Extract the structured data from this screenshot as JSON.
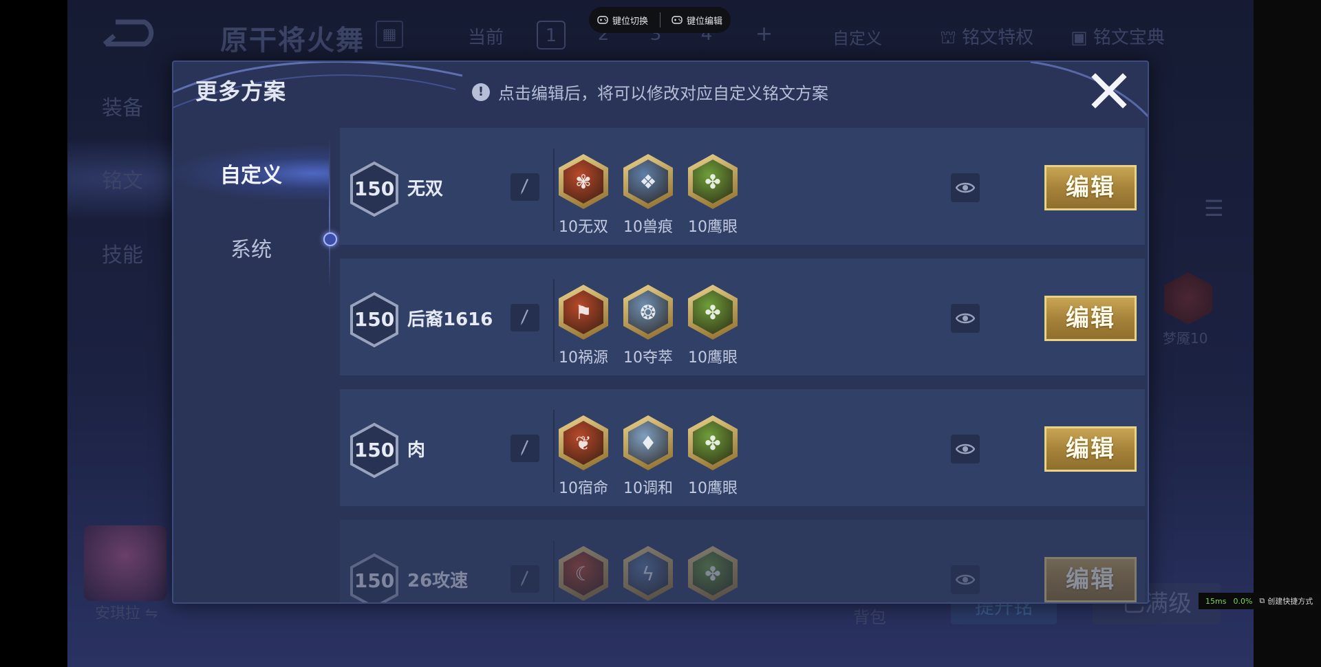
{
  "background": {
    "hero_name": "原干将火舞",
    "current_label": "当前",
    "pages": [
      "1",
      "2",
      "3",
      "4"
    ],
    "add_label": "+",
    "custom_label": "自定义",
    "privilege_label": "铭文特权",
    "codex_label": "铭文宝典",
    "tabs": [
      "装备",
      "铭文",
      "技能"
    ],
    "rune_label": "梦魇10",
    "player_name": "安琪拉",
    "bag_label": "背包",
    "button1_label": "提升铭",
    "button2_label": "已满级"
  },
  "toolbar": {
    "switch_label": "键位切换",
    "edit_label": "键位编辑"
  },
  "dialog": {
    "title": "更多方案",
    "hint": "点击编辑后，将可以修改对应自定义铭文方案",
    "hint_icon": "!",
    "tabs": {
      "custom": "自定义",
      "system": "系统"
    }
  },
  "schemes": [
    {
      "level": "150",
      "name": "无双",
      "runes": [
        {
          "label": "10无双",
          "color": "#b8492a",
          "icon": "rose-rune"
        },
        {
          "label": "10兽痕",
          "color": "#5f7fa8",
          "icon": "claw-rune"
        },
        {
          "label": "10鹰眼",
          "color": "#6f9e3a",
          "icon": "clover-rune"
        }
      ],
      "edit_label": "编辑"
    },
    {
      "level": "150",
      "name": "后裔1616",
      "runes": [
        {
          "label": "10祸源",
          "color": "#b8492a",
          "icon": "flag-rune"
        },
        {
          "label": "10夺萃",
          "color": "#6f8fb0",
          "icon": "knot-rune"
        },
        {
          "label": "10鹰眼",
          "color": "#6f9e3a",
          "icon": "clover-rune"
        }
      ],
      "edit_label": "编辑"
    },
    {
      "level": "150",
      "name": "肉",
      "runes": [
        {
          "label": "10宿命",
          "color": "#b8492a",
          "icon": "flame-rune"
        },
        {
          "label": "10调和",
          "color": "#7f9fc0",
          "icon": "drop-rune"
        },
        {
          "label": "10鹰眼",
          "color": "#6f9e3a",
          "icon": "clover-rune"
        }
      ],
      "edit_label": "编辑"
    },
    {
      "level": "150",
      "name": "26攻速",
      "runes": [
        {
          "label": "",
          "color": "#b8492a",
          "icon": "moon-rune"
        },
        {
          "label": "",
          "color": "#5f7fa8",
          "icon": "bolt-rune"
        },
        {
          "label": "",
          "color": "#6f9e3a",
          "icon": "clover-rune"
        }
      ],
      "edit_label": "编辑"
    }
  ],
  "status": {
    "ping": "15ms",
    "loss": "0.0%",
    "shortcut": "创建快捷方式"
  }
}
